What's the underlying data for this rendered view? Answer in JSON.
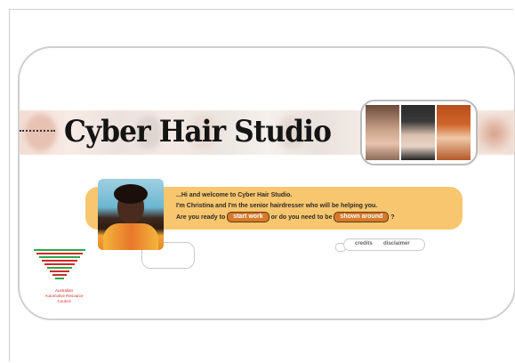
{
  "site": {
    "title": "Cyber Hair Studio"
  },
  "welcome": {
    "line1": "...Hi and welcome to Cyber Hair Studio.",
    "line2": "I'm Christina and I'm the senior hairdresser who will be helping you.",
    "line3_prefix": "Are you ready to",
    "line3_middle": "or do you need to be",
    "line3_suffix": "?",
    "start_work_label": "start work",
    "shown_around_label": "shown around"
  },
  "footer_links": {
    "credits_label": "credits",
    "disclaimer_label": "disclaimer"
  },
  "logo": {
    "text_lines": [
      "Australian",
      "Automotive Resource",
      "Council"
    ]
  },
  "colors": {
    "bubble": "#f7c66e",
    "pill": "#d77a2a",
    "logo_red": "#d12a2a",
    "logo_green": "#2aa84a"
  },
  "icons": [
    "christina-avatar",
    "model-photo-1",
    "model-photo-2",
    "model-photo-3",
    "organisation-logo"
  ]
}
